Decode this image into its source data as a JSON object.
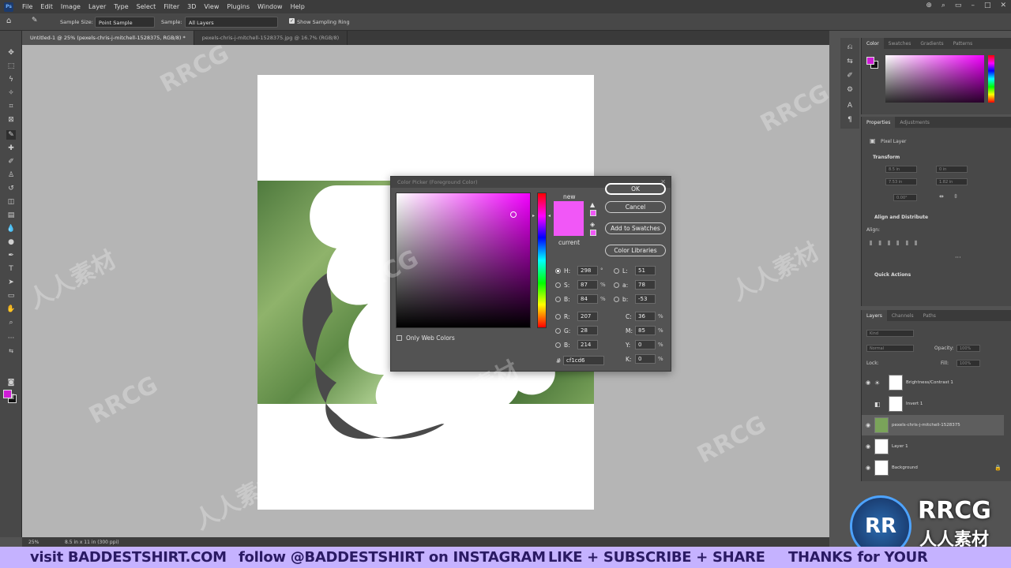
{
  "menu": {
    "app_icon": "Ps",
    "items": [
      "File",
      "Edit",
      "Image",
      "Layer",
      "Type",
      "Select",
      "Filter",
      "3D",
      "View",
      "Plugins",
      "Window",
      "Help"
    ]
  },
  "options": {
    "sample_size_label": "Sample Size:",
    "sample_size_value": "Point Sample",
    "sample_label": "Sample:",
    "sample_value": "All Layers",
    "show_ring_label": "Show Sampling Ring"
  },
  "tabs": [
    "Untitled-1 @ 25% (pexels-chris-j-mitchell-1528375, RGB/8) *",
    "pexels-chris-j-mitchell-1528375.jpg @ 16.7% (RGB/8)"
  ],
  "status": {
    "zoom": "25%",
    "doc_info": "8.5 in x 11 in (300 ppi)"
  },
  "color_panel": {
    "tabs": [
      "Color",
      "Swatches",
      "Gradients",
      "Patterns"
    ]
  },
  "properties_panel": {
    "tabs": [
      "Properties",
      "Adjustments"
    ],
    "layer_type": "Pixel Layer",
    "transform_title": "Transform",
    "w_value": "8.5 in",
    "x_value": "0 in",
    "h_value": "7.53 in",
    "y_value": "1.82 in",
    "angle_value": "0.00°",
    "align_title": "Align and Distribute",
    "align_label": "Align:",
    "quick_actions_title": "Quick Actions"
  },
  "layers_panel": {
    "tabs": [
      "Layers",
      "Channels",
      "Paths"
    ],
    "kind_placeholder": "Kind",
    "blend_mode": "Normal",
    "opacity_label": "Opacity:",
    "opacity_value": "100%",
    "lock_label": "Lock:",
    "fill_label": "Fill:",
    "fill_value": "100%",
    "layers": [
      {
        "name": "Brightness/Contrast 1"
      },
      {
        "name": "Invert 1"
      },
      {
        "name": "pexels-chris-j-mitchell-1528375"
      },
      {
        "name": "Layer 1"
      },
      {
        "name": "Background"
      }
    ]
  },
  "color_picker": {
    "title": "Color Picker (Foreground Color)",
    "new_label": "new",
    "current_label": "current",
    "ok_label": "OK",
    "cancel_label": "Cancel",
    "add_swatches_label": "Add to Swatches",
    "color_libraries_label": "Color Libraries",
    "only_web_colors_label": "Only Web Colors",
    "new_color": "#f157f7",
    "current_color": "#f157f7",
    "hsb": {
      "H": "298",
      "S": "87",
      "B": "84"
    },
    "rgb": {
      "R": "207",
      "G": "28",
      "B": "214"
    },
    "lab": {
      "L": "51",
      "a": "78",
      "b": "-53"
    },
    "cmyk": {
      "C": "36",
      "M": "85",
      "Y": "0",
      "K": "0"
    },
    "hex": "cf1cd6",
    "units": {
      "deg": "°",
      "pct": "%"
    }
  },
  "banner": {
    "part1": "visit BADDESTSHIRT.COM",
    "part2": "follow @BADDESTSHIRT on INSTAGRAM",
    "part3": "LIKE + SUBSCRIBE + SHARE",
    "part4": "THANKS for YOUR SUPPORT!"
  },
  "watermark": {
    "text_en": "RRCG",
    "text_cn": "人人素材",
    "logo_badge": "RR",
    "logo_title": "RRCG",
    "logo_sub": "人人素材"
  },
  "colors": {
    "foreground": "#cf1cd6",
    "banner_bg": "#c5b2ff",
    "canvas_bg": "#b5b5b5"
  }
}
